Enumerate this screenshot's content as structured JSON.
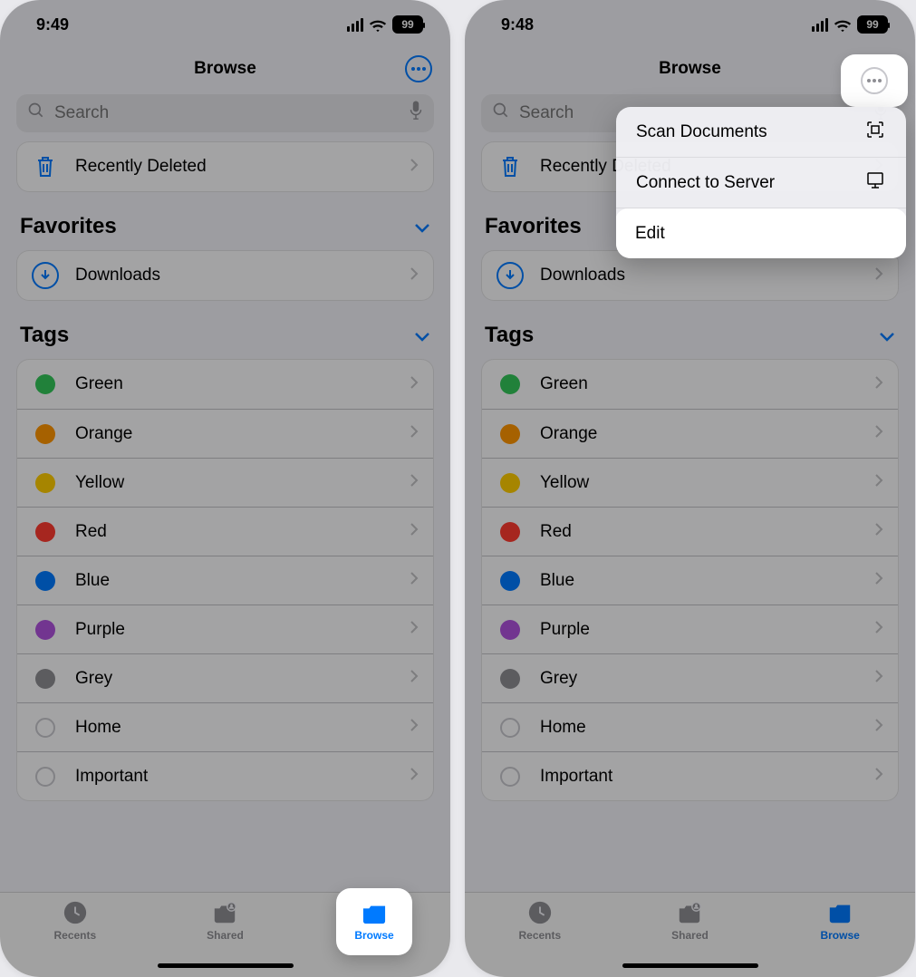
{
  "left": {
    "time": "9:49",
    "battery": "99",
    "title": "Browse",
    "search_placeholder": "Search",
    "recently_deleted": "Recently Deleted",
    "favorites_header": "Favorites",
    "downloads": "Downloads",
    "tags_header": "Tags",
    "tags": [
      {
        "label": "Green",
        "color": "#34c759"
      },
      {
        "label": "Orange",
        "color": "#ff9500"
      },
      {
        "label": "Yellow",
        "color": "#ffcc00"
      },
      {
        "label": "Red",
        "color": "#ff3b30"
      },
      {
        "label": "Blue",
        "color": "#007aff"
      },
      {
        "label": "Purple",
        "color": "#af52de"
      },
      {
        "label": "Grey",
        "color": "#8e8e93"
      },
      {
        "label": "Home",
        "color": "hollow"
      },
      {
        "label": "Important",
        "color": "hollow"
      }
    ],
    "tabs": {
      "recents": "Recents",
      "shared": "Shared",
      "browse": "Browse"
    }
  },
  "right": {
    "time": "9:48",
    "battery": "99",
    "title": "Browse",
    "search_placeholder": "Search",
    "recently_deleted": "Recently Deleted",
    "favorites_header": "Favorites",
    "downloads": "Downloads",
    "tags_header": "Tags",
    "tags": [
      {
        "label": "Green",
        "color": "#34c759"
      },
      {
        "label": "Orange",
        "color": "#ff9500"
      },
      {
        "label": "Yellow",
        "color": "#ffcc00"
      },
      {
        "label": "Red",
        "color": "#ff3b30"
      },
      {
        "label": "Blue",
        "color": "#007aff"
      },
      {
        "label": "Purple",
        "color": "#af52de"
      },
      {
        "label": "Grey",
        "color": "#8e8e93"
      },
      {
        "label": "Home",
        "color": "hollow"
      },
      {
        "label": "Important",
        "color": "hollow"
      }
    ],
    "tabs": {
      "recents": "Recents",
      "shared": "Shared",
      "browse": "Browse"
    },
    "menu": {
      "scan": "Scan Documents",
      "connect": "Connect to Server",
      "edit": "Edit"
    }
  }
}
